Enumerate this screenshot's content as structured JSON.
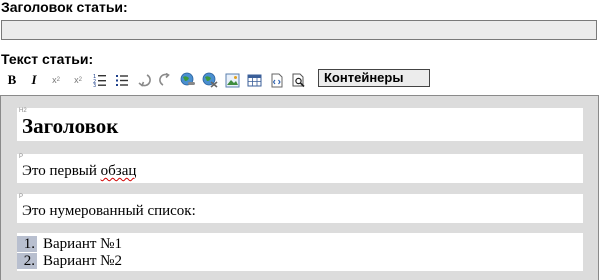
{
  "form": {
    "title_label": "Заголовок статьи:",
    "title_value": "",
    "body_label": "Текст статьи:"
  },
  "toolbar": {
    "bold": "B",
    "italic": "I",
    "superscript": "x",
    "superscript_mark": "2",
    "subscript": "x",
    "subscript_mark": "2",
    "containers_label": "Контейнеры",
    "icons": [
      "numbered-list-icon",
      "bullet-list-icon",
      "undo-icon",
      "redo-icon",
      "insert-link-icon",
      "remove-link-icon",
      "insert-image-icon",
      "insert-table-icon",
      "source-code-icon",
      "preview-icon"
    ]
  },
  "editor": {
    "heading": {
      "tag": "H2",
      "text": "Заголовок"
    },
    "paragraph1": {
      "tag": "P",
      "text_before": "Это первый ",
      "misspelled": "обзац"
    },
    "paragraph2": {
      "tag": "P",
      "text": "Это нумерованный список:"
    },
    "list": [
      {
        "num": "1.",
        "text": "Вариант №1"
      },
      {
        "num": "2.",
        "text": "Вариант №2"
      }
    ]
  },
  "colors": {
    "editor_bg": "#dcdcdc",
    "block_bg": "#ffffff",
    "input_bg": "#ececec",
    "list_number_highlight": "#b8bfcf",
    "spellcheck_underline": "#d00000"
  }
}
